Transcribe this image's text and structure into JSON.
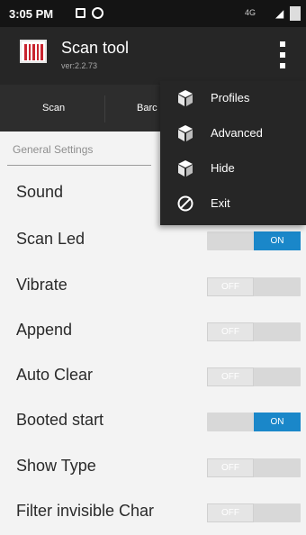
{
  "status_bar": {
    "time": "3:05 PM",
    "network": "4G"
  },
  "app": {
    "title": "Scan tool",
    "version": "ver:2.2.73"
  },
  "tabs": [
    {
      "label": "Scan"
    },
    {
      "label": "Barc"
    }
  ],
  "section": {
    "title": "General Settings"
  },
  "settings": [
    {
      "label": "Sound",
      "state": ""
    },
    {
      "label": "Scan Led",
      "state": "ON"
    },
    {
      "label": "Vibrate",
      "state": "OFF"
    },
    {
      "label": "Append",
      "state": "OFF"
    },
    {
      "label": "Auto Clear",
      "state": "OFF"
    },
    {
      "label": "Booted start",
      "state": "ON"
    },
    {
      "label": "Show Type",
      "state": "OFF"
    },
    {
      "label": "Filter invisible Char",
      "state": "OFF"
    }
  ],
  "overflow_menu": {
    "items": [
      {
        "label": "Profiles",
        "icon": "cube-icon"
      },
      {
        "label": "Advanced",
        "icon": "cube-icon"
      },
      {
        "label": "Hide",
        "icon": "cube-icon"
      },
      {
        "label": "Exit",
        "icon": "block-icon"
      }
    ]
  },
  "colors": {
    "accent": "#1a87c9",
    "appbar": "#262626",
    "background": "#f3f3f3"
  }
}
